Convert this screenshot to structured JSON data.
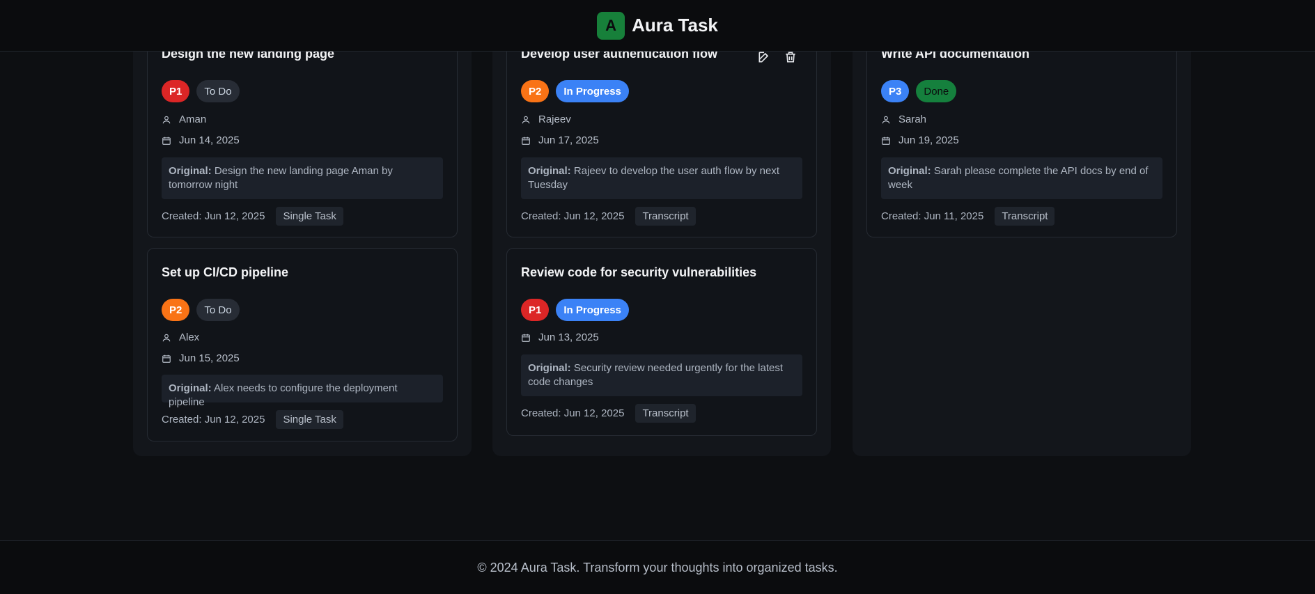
{
  "header": {
    "logo_letter": "A",
    "app_name": "Aura Task"
  },
  "columns": [
    {
      "cards": [
        {
          "title": "Design the new landing page",
          "priority": "P1",
          "status": "To Do",
          "assignee": "Aman",
          "due": "Jun 14, 2025",
          "original_label": "Original:",
          "original_text": "Design the new landing page Aman by tomorrow night",
          "created": "Created: Jun 12, 2025",
          "source": "Single Task"
        },
        {
          "title": "Set up CI/CD pipeline",
          "priority": "P2",
          "status": "To Do",
          "assignee": "Alex",
          "due": "Jun 15, 2025",
          "original_label": "Original:",
          "original_text": "Alex needs to configure the deployment pipeline",
          "created": "Created: Jun 12, 2025",
          "source": "Single Task"
        }
      ]
    },
    {
      "cards": [
        {
          "title": "Develop user authentication flow",
          "priority": "P2",
          "status": "In Progress",
          "assignee": "Rajeev",
          "due": "Jun 17, 2025",
          "original_label": "Original:",
          "original_text": "Rajeev to develop the user auth flow by next Tuesday",
          "created": "Created: Jun 12, 2025",
          "source": "Transcript"
        },
        {
          "title": "Review code for security vulnerabilities",
          "priority": "P1",
          "status": "In Progress",
          "due": "Jun 13, 2025",
          "original_label": "Original:",
          "original_text": "Security review needed urgently for the latest code changes",
          "created": "Created: Jun 12, 2025",
          "source": "Transcript"
        }
      ]
    },
    {
      "cards": [
        {
          "title": "Write API documentation",
          "priority": "P3",
          "status": "Done",
          "assignee": "Sarah",
          "due": "Jun 19, 2025",
          "original_label": "Original:",
          "original_text": "Sarah please complete the API docs by end of week",
          "created": "Created: Jun 11, 2025",
          "source": "Transcript"
        }
      ]
    }
  ],
  "icons": {
    "user": "user-icon",
    "calendar": "calendar-icon",
    "edit": "edit-icon",
    "delete": "trash-icon"
  },
  "colors": {
    "p1": "#dc2626",
    "p2": "#f97316",
    "p3": "#3b82f6",
    "in_progress": "#3b82f6",
    "done": "#15803d",
    "logo": "#17803a"
  },
  "footer": {
    "text": "© 2024 Aura Task. Transform your thoughts into organized tasks."
  }
}
